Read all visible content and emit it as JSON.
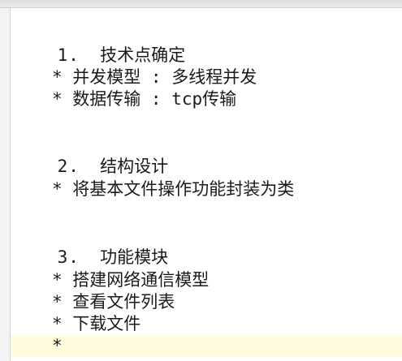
{
  "document": {
    "sections": [
      {
        "heading_number": "1.",
        "heading_text": "技术点确定",
        "items": [
          "* 并发模型 : 多线程并发",
          "* 数据传输 : tcp传输"
        ]
      },
      {
        "heading_number": "2.",
        "heading_text": "结构设计",
        "items": [
          "* 将基本文件操作功能封装为类"
        ]
      },
      {
        "heading_number": "3.",
        "heading_text": "功能模块",
        "items": [
          "* 搭建网络通信模型",
          "* 查看文件列表",
          "* 下载文件",
          "*"
        ]
      }
    ]
  }
}
